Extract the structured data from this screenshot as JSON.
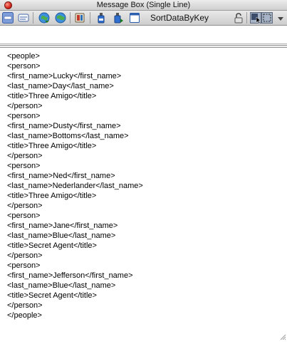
{
  "window": {
    "title": "Message Box (Single Line)"
  },
  "toolbar": {
    "sort_label": "SortDataByKey",
    "icons": [
      "single-line-icon",
      "multi-line-icon",
      "globe-arrow-icon",
      "globe-icon",
      "book-icon",
      "bottle-icon",
      "bottle-play-icon",
      "window-icon",
      "lock-icon",
      "pointer-box-icon",
      "marquee-icon",
      "dropdown-arrow-icon"
    ]
  },
  "input": {
    "value": "",
    "placeholder": ""
  },
  "output": {
    "lines": [
      "<people>",
      "<person>",
      "<first_name>Lucky</first_name>",
      "<last_name>Day</last_name>",
      "<title>Three Amigo</title>",
      "</person>",
      "<person>",
      "<first_name>Dusty</first_name>",
      "<last_name>Bottoms</last_name>",
      "<title>Three Amigo</title>",
      "</person>",
      "<person>",
      "<first_name>Ned</first_name>",
      "<last_name>Nederlander</last_name>",
      "<title>Three Amigo</title>",
      "</person>",
      "<person>",
      "<first_name>Jane</first_name>",
      "<last_name>Blue</last_name>",
      "<title>Secret Agent</title>",
      "</person>",
      "<person>",
      "<first_name>Jefferson</first_name>",
      "<last_name>Blue</last_name>",
      "<title>Secret Agent</title>",
      "</person>",
      "</people>"
    ]
  }
}
